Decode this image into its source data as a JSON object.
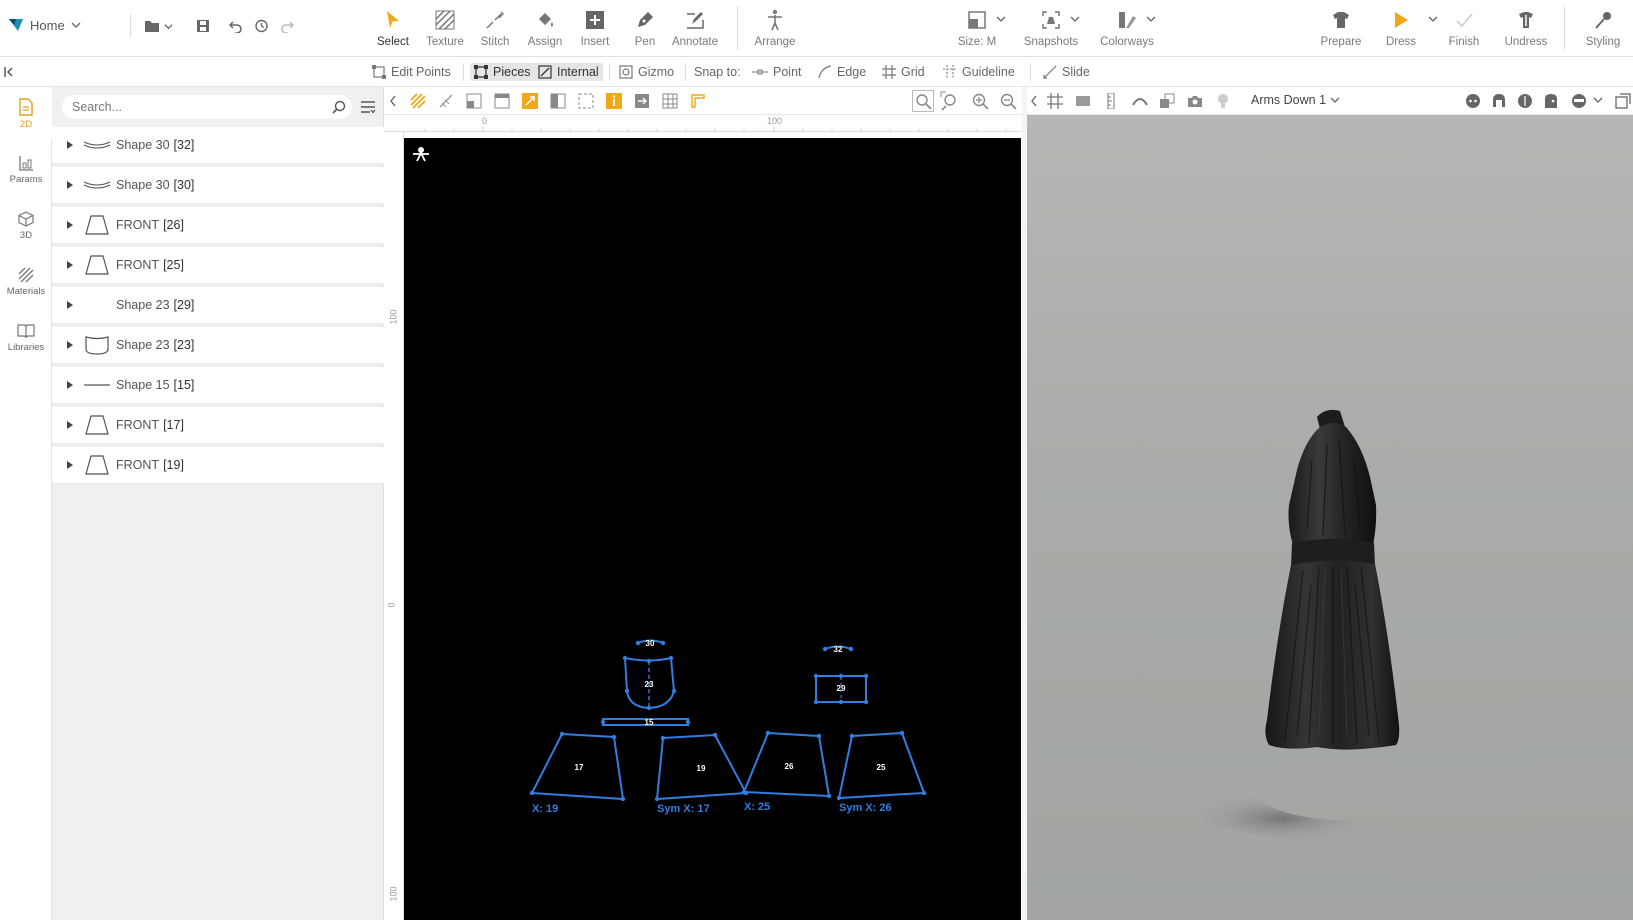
{
  "topbar": {
    "home_label": "Home",
    "tools": [
      {
        "label": "Select",
        "icon": "select-cursor-icon"
      },
      {
        "label": "Texture",
        "icon": "texture-hatch-icon"
      },
      {
        "label": "Stitch",
        "icon": "stitch-icon"
      },
      {
        "label": "Assign",
        "icon": "assign-bucket-icon"
      },
      {
        "label": "Insert",
        "icon": "insert-plus-icon"
      },
      {
        "label": "Pen",
        "icon": "pen-icon"
      },
      {
        "label": "Annotate",
        "icon": "annotate-icon"
      },
      {
        "label": "Arrange",
        "icon": "arrange-figure-icon"
      },
      {
        "label": "Size: M",
        "icon": "size-icon"
      },
      {
        "label": "Snapshots",
        "icon": "snapshots-icon"
      },
      {
        "label": "Colorways",
        "icon": "colorways-icon"
      },
      {
        "label": "Prepare",
        "icon": "prepare-shirt-icon"
      },
      {
        "label": "Dress",
        "icon": "dress-play-icon"
      },
      {
        "label": "Finish",
        "icon": "finish-check-icon"
      },
      {
        "label": "Undress",
        "icon": "undress-icon"
      },
      {
        "label": "Styling",
        "icon": "styling-pin-icon"
      }
    ],
    "accent_color": "#f0a818"
  },
  "subbar": {
    "edit_points": "Edit Points",
    "pieces": "Pieces",
    "internal": "Internal",
    "gizmo": "Gizmo",
    "snap_to": "Snap to:",
    "point": "Point",
    "edge": "Edge",
    "grid": "Grid",
    "guideline": "Guideline",
    "slide": "Slide"
  },
  "leftrail": {
    "items": [
      {
        "label": "2D",
        "icon": "pattern-2d-icon",
        "active": true
      },
      {
        "label": "Params",
        "icon": "params-icon",
        "active": false
      },
      {
        "label": "3D",
        "icon": "cube-3d-icon",
        "active": false
      },
      {
        "label": "Materials",
        "icon": "materials-hatch-icon",
        "active": false
      },
      {
        "label": "Libraries",
        "icon": "book-icon",
        "active": false
      }
    ]
  },
  "panel": {
    "search_placeholder": "Search...",
    "items": [
      {
        "name": "Shape 30",
        "index": "[32]",
        "thumb": "curve"
      },
      {
        "name": "Shape 30",
        "index": "[30]",
        "thumb": "curve"
      },
      {
        "name": "FRONT",
        "index": "[26]",
        "thumb": "trapezoid"
      },
      {
        "name": "FRONT",
        "index": "[25]",
        "thumb": "trapezoid"
      },
      {
        "name": "Shape 23",
        "index": "[29]",
        "thumb": "none"
      },
      {
        "name": "Shape 23",
        "index": "[23]",
        "thumb": "bodice"
      },
      {
        "name": "Shape 15",
        "index": "[15]",
        "thumb": "line"
      },
      {
        "name": "FRONT",
        "index": "[17]",
        "thumb": "trapezoid"
      },
      {
        "name": "FRONT",
        "index": "[19]",
        "thumb": "trapezoid"
      }
    ]
  },
  "view2d": {
    "ruler_top_labels": [
      "0",
      "100"
    ],
    "ruler_left_labels": [
      "100",
      "0",
      "100"
    ],
    "pieces": [
      {
        "id": "30",
        "label": "30"
      },
      {
        "id": "23",
        "label": "23"
      },
      {
        "id": "15",
        "label": "15"
      },
      {
        "id": "32",
        "label": "32"
      },
      {
        "id": "29",
        "label": "29"
      },
      {
        "id": "17",
        "label": "17"
      },
      {
        "id": "19",
        "label": "19"
      },
      {
        "id": "26",
        "label": "26"
      },
      {
        "id": "25",
        "label": "25"
      }
    ],
    "sym_labels": [
      "X: 19",
      "Sym X: 17",
      "X: 25",
      "Sym X: 26"
    ],
    "piece_color": "#2f7ee0"
  },
  "view3d": {
    "avatar_pose": "Arms Down 1"
  }
}
